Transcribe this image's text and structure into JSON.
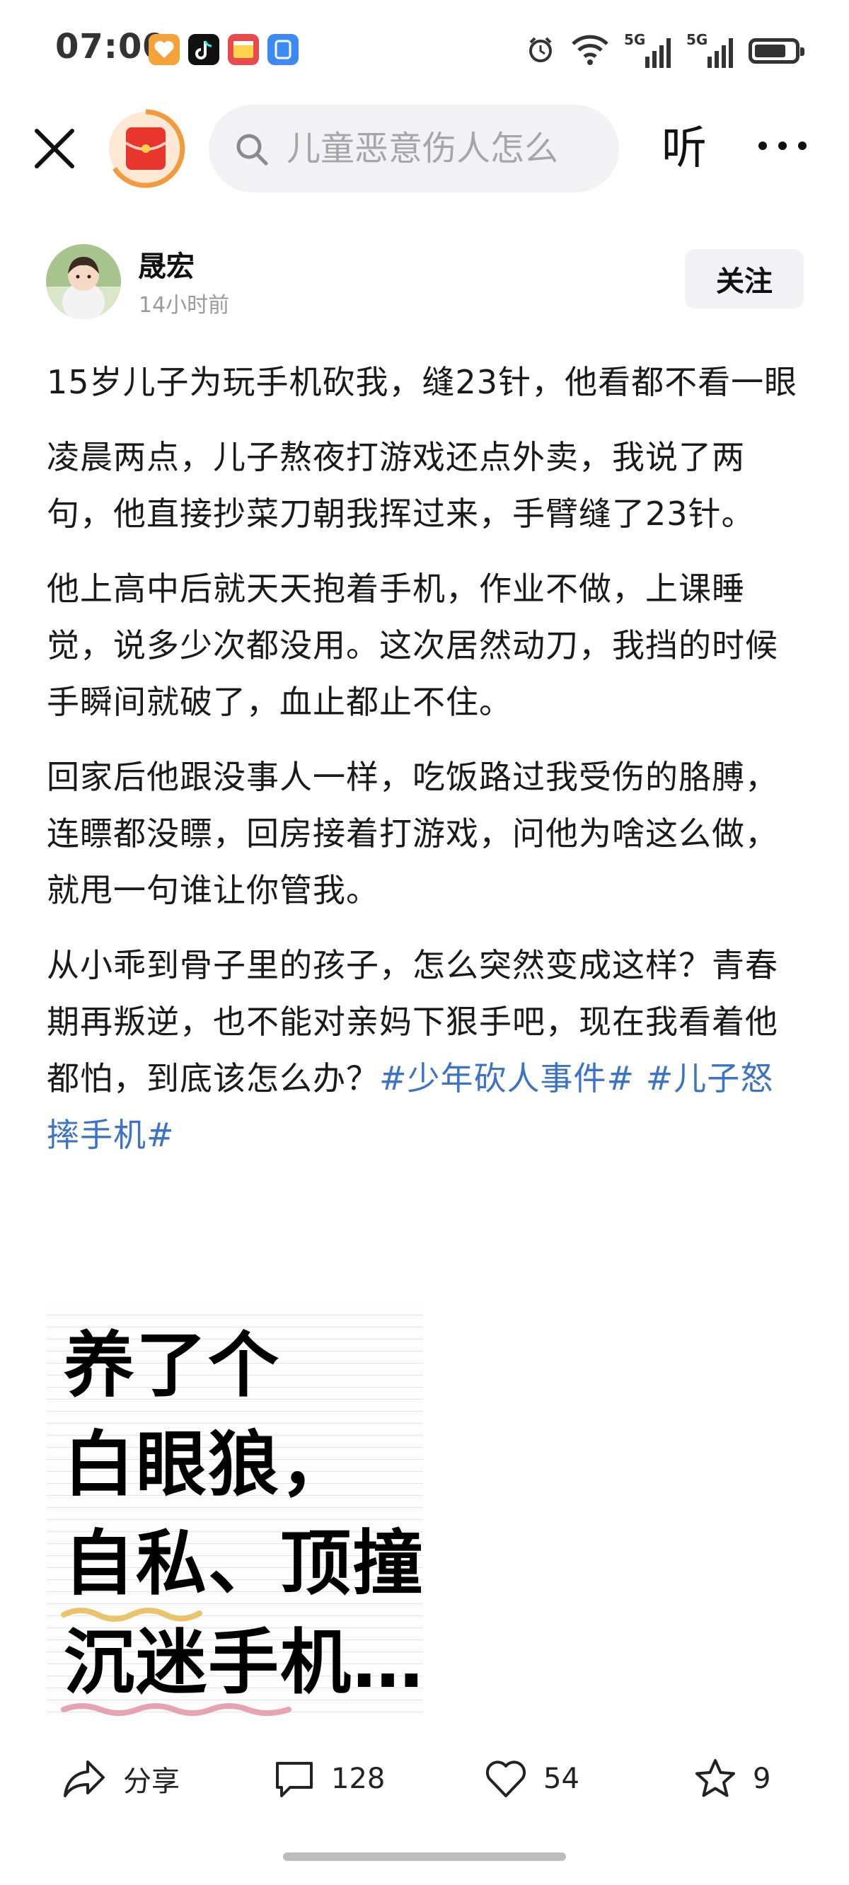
{
  "status_bar": {
    "time": "07:00",
    "network_1": "5G",
    "network_2": "5G",
    "battery_percent": 80
  },
  "top_nav": {
    "search_placeholder": "儿童恶意伤人怎么",
    "listen_label": "听"
  },
  "author": {
    "name": "晟宏",
    "time_ago": "14小时前",
    "follow_label": "关注"
  },
  "post": {
    "title": "15岁儿子为玩手机砍我，缝23针，他看都不看一眼",
    "paragraphs": [
      "凌晨两点，儿子熬夜打游戏还点外卖，我说了两句，他直接抄菜刀朝我挥过来，手臂缝了23针。",
      "他上高中后就天天抱着手机，作业不做，上课睡觉，说多少次都没用。这次居然动刀，我挡的时候手瞬间就破了，血止都止不住。",
      "回家后他跟没事人一样，吃饭路过我受伤的胳膊，连瞟都没瞟，回房接着打游戏，问他为啥这么做，就甩一句谁让你管我。"
    ],
    "last_paragraph": "从小乖到骨子里的孩子，怎么突然变成这样？青春期再叛逆，也不能对亲妈下狠手吧，现在我看着他都怕，到底该怎么办？",
    "hashtags": [
      "#少年砍人事件#",
      "#儿子怒摔手机#"
    ]
  },
  "image_text": {
    "line1": "养了个",
    "line2": "白眼狼，",
    "line3": "自私、顶撞、",
    "line4": "沉迷手机…"
  },
  "actions": {
    "share_label": "分享",
    "comment_count": "128",
    "like_count": "54",
    "favorite_count": "9"
  },
  "colors": {
    "hashtag": "#3c73c4",
    "logo_red": "#e8362c",
    "logo_ring": "#f39a3a"
  }
}
